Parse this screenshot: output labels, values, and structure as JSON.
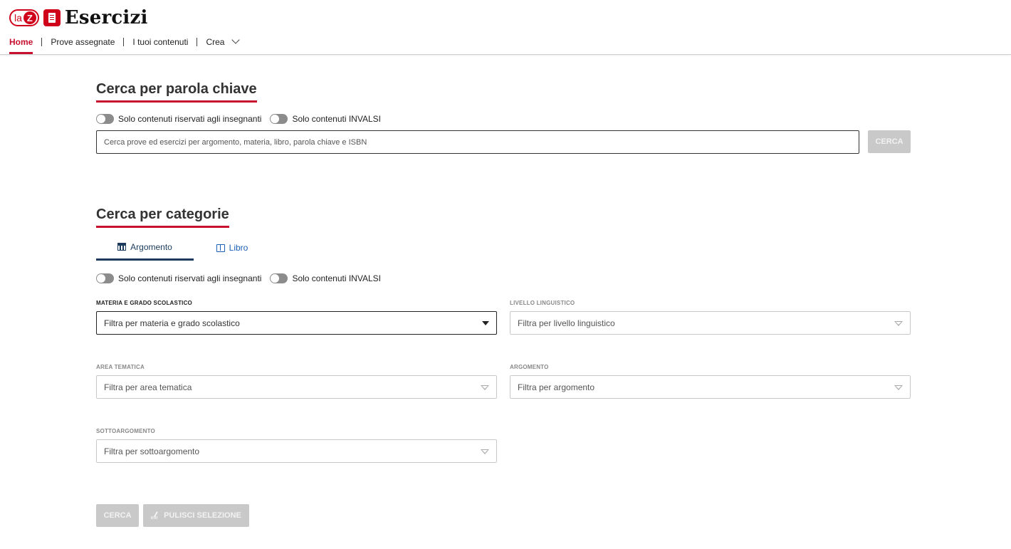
{
  "header": {
    "logo_la": "la",
    "logo_z": "Z",
    "app_title": "Esercizi",
    "nav": [
      {
        "label": "Home",
        "active": true
      },
      {
        "label": "Prove assegnate"
      },
      {
        "label": "I tuoi contenuti"
      },
      {
        "label": "Crea"
      }
    ]
  },
  "keyword_search": {
    "title": "Cerca per parola chiave",
    "toggle_teachers": "Solo contenuti riservati agli insegnanti",
    "toggle_invalsi": "Solo contenuti INVALSI",
    "placeholder": "Cerca prove ed esercizi per argomento, materia, libro, parola chiave e ISBN",
    "button": "CERCA"
  },
  "category_search": {
    "title": "Cerca per categorie",
    "tabs": [
      {
        "label": "Argomento",
        "icon": "grid-icon",
        "active": true
      },
      {
        "label": "Libro",
        "icon": "book-icon"
      }
    ],
    "toggle_teachers": "Solo contenuti riservati agli insegnanti",
    "toggle_invalsi": "Solo contenuti INVALSI",
    "filters": {
      "materia": {
        "label": "MATERIA E GRADO SCOLASTICO",
        "placeholder": "Filtra per materia e grado scolastico"
      },
      "livello": {
        "label": "LIVELLO LINGUISTICO",
        "placeholder": "Filtra per livello linguistico"
      },
      "area": {
        "label": "AREA TEMATICA",
        "placeholder": "Filtra per area tematica"
      },
      "argomento": {
        "label": "ARGOMENTO",
        "placeholder": "Filtra per argomento"
      },
      "sottoargomento": {
        "label": "SOTTOARGOMENTO",
        "placeholder": "Filtra per sottoargomento"
      }
    },
    "search_button": "CERCA",
    "clear_button": "PULISCI SELEZIONE"
  },
  "colors": {
    "brand_red": "#c8102e",
    "tab_active": "#1b3a5c",
    "link_blue": "#1a5fb4",
    "disabled": "#c9c9c9"
  }
}
